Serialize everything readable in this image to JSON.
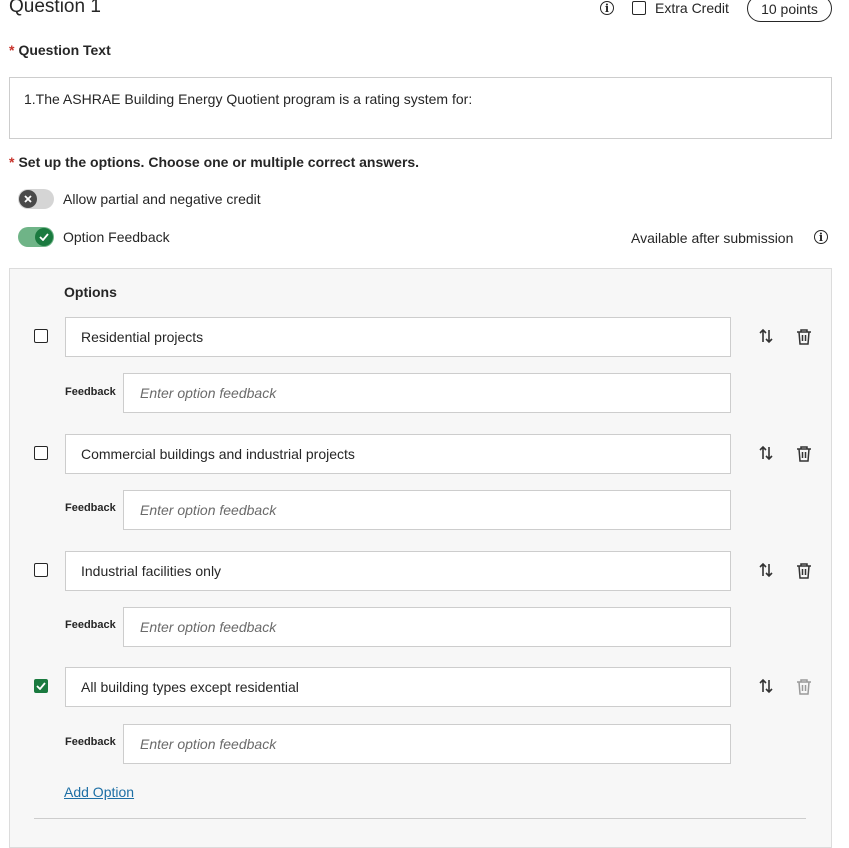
{
  "header": {
    "title": "Question 1",
    "info_icon": "info-icon",
    "extra_credit_label": "Extra Credit",
    "extra_credit_checked": false,
    "points": "10 points"
  },
  "question_text": {
    "label": "Question Text",
    "value": "1.The ASHRAE Building Energy Quotient program is a rating system for:"
  },
  "options_setup": {
    "label": "Set up the options. Choose one or multiple correct answers.",
    "partial_credit_label": "Allow partial and negative credit",
    "partial_credit_on": false,
    "option_feedback_label": "Option Feedback",
    "option_feedback_on": true,
    "available_after": "Available after submission"
  },
  "options_panel": {
    "heading": "Options",
    "feedback_label": "Feedback",
    "feedback_placeholder": "Enter option feedback",
    "options": [
      {
        "text": "Residential projects",
        "correct": false
      },
      {
        "text": "Commercial buildings and industrial projects",
        "correct": false
      },
      {
        "text": "Industrial facilities only",
        "correct": false
      },
      {
        "text": "All building types except residential",
        "correct": true
      }
    ],
    "add_option_label": "Add Option"
  },
  "colors": {
    "required": "#c8332b",
    "accent_green": "#1a7a3f",
    "link": "#1d6fa5"
  }
}
